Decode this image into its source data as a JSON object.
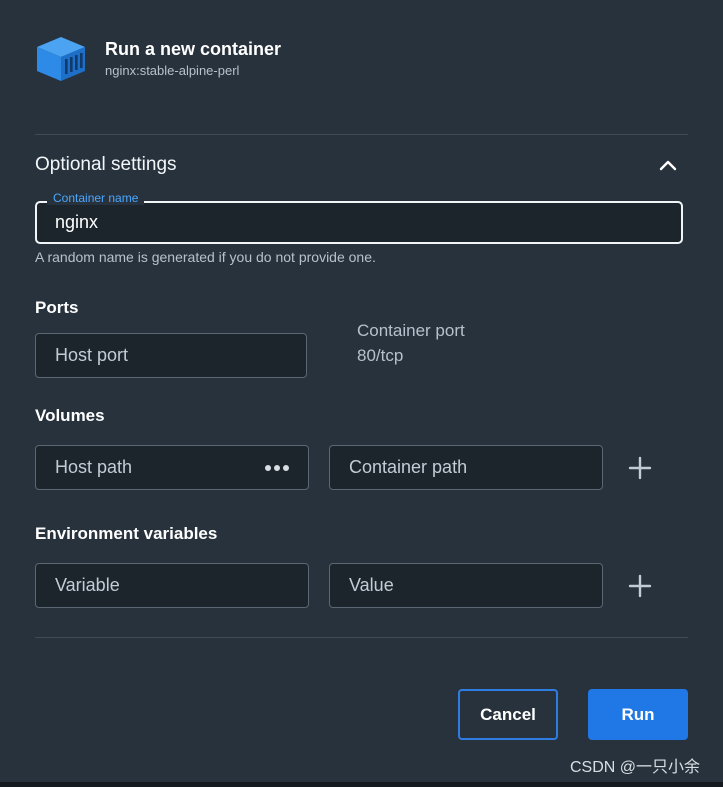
{
  "header": {
    "title": "Run a new container",
    "image": "nginx:stable-alpine-perl",
    "icon": "docker-container-icon"
  },
  "optional_settings": {
    "title": "Optional settings",
    "collapse_icon": "chevron-up-icon",
    "expanded": true
  },
  "container_name": {
    "label": "Container name",
    "value": "nginx",
    "helper": "A random name is generated if you do not provide one."
  },
  "ports": {
    "title": "Ports",
    "host_port_placeholder": "Host port",
    "container_port_label": "Container port",
    "container_port_value": "80/tcp"
  },
  "volumes": {
    "title": "Volumes",
    "host_path_placeholder": "Host path",
    "browse_icon": "more-horizontal-icon",
    "container_path_placeholder": "Container path",
    "add_icon": "plus-icon"
  },
  "env": {
    "title": "Environment variables",
    "variable_placeholder": "Variable",
    "value_placeholder": "Value",
    "add_icon": "plus-icon"
  },
  "actions": {
    "cancel": "Cancel",
    "run": "Run"
  },
  "watermark": "CSDN @一只小余",
  "colors": {
    "background": "#27323d",
    "input_background": "#1c252c",
    "accent": "#1f78e5",
    "label_accent": "#4aa8ff"
  }
}
